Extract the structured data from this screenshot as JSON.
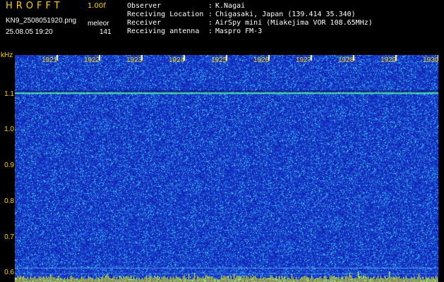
{
  "header": {
    "app_title": "HROFFT",
    "version": "1.00f",
    "filename": "KN9_2508051920.png",
    "mode_label": "meleor",
    "datetime": "25.08.05 19:20",
    "count": "141"
  },
  "metadata": [
    {
      "label": "Observer",
      "value": "K.Nagai"
    },
    {
      "label": "Receiving Location",
      "value": "Chigasaki, Japan (139.414 35.340)"
    },
    {
      "label": "Receiver",
      "value": "AirSpy mini (Miakejima VOR 108.65MHz)"
    },
    {
      "label": "Receiving antenna",
      "value": "Maspro FM-3"
    }
  ],
  "colors": {
    "background": "#000000",
    "label_yellow": "#ffd400",
    "spectrogram_blue": "#1530c8",
    "noise_cyan": "#40e0ff",
    "signal_line": "#4ee8a0",
    "bottom_bar": "#ffff00"
  },
  "spectrogram": {
    "y_unit": "kHz",
    "y_ticks": [
      "1.1",
      "1.0",
      "0.9",
      "0.8",
      "0.7",
      "0.6"
    ],
    "y_values": [
      1.1,
      1.0,
      0.9,
      0.8,
      0.7,
      0.6
    ],
    "time_ticks": [
      "1921",
      "1922",
      "1923",
      "1924",
      "1925",
      "1926",
      "1927",
      "1928",
      "1929",
      "1930"
    ],
    "time_minutes": [
      1921,
      1922,
      1923,
      1924,
      1925,
      1926,
      1927,
      1928,
      1929,
      1930
    ],
    "time_start": 1920,
    "time_end": 1930,
    "freq_min": 0.575,
    "freq_max": 1.21,
    "carrier_freq": 1.105,
    "secondary_line_freq": 0.615
  }
}
